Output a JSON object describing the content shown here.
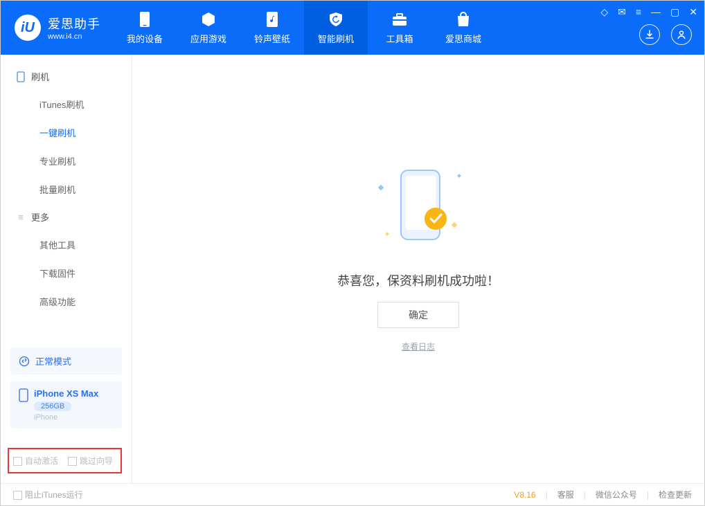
{
  "app": {
    "name_cn": "爱思助手",
    "url": "www.i4.cn",
    "logo_letter": "iU"
  },
  "tabs": [
    {
      "label": "我的设备"
    },
    {
      "label": "应用游戏"
    },
    {
      "label": "铃声壁纸"
    },
    {
      "label": "智能刷机",
      "active": true
    },
    {
      "label": "工具箱"
    },
    {
      "label": "爱思商城"
    }
  ],
  "sidebar": {
    "groups": [
      {
        "title": "刷机",
        "items": [
          "iTunes刷机",
          "一键刷机",
          "专业刷机",
          "批量刷机"
        ],
        "active_index": 1
      },
      {
        "title": "更多",
        "items": [
          "其他工具",
          "下载固件",
          "高级功能"
        ],
        "active_index": -1
      }
    ],
    "mode_card": "正常模式",
    "device": {
      "name": "iPhone XS Max",
      "capacity": "256GB",
      "sub": "iPhone"
    },
    "option_auto_activate": "自动激活",
    "option_skip_guide": "跳过向导"
  },
  "main": {
    "success_text": "恭喜您，保资料刷机成功啦！",
    "ok_button": "确定",
    "view_log": "查看日志"
  },
  "footer": {
    "block_itunes": "阻止iTunes运行",
    "version": "V8.16",
    "links": [
      "客服",
      "微信公众号",
      "检查更新"
    ]
  }
}
